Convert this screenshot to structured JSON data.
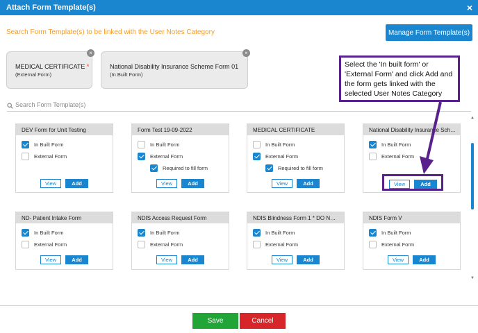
{
  "dialog": {
    "title": "Attach Form Template(s)",
    "close_icon": "×"
  },
  "header": {
    "subtitle": "Search Form Template(s) to be linked with the User Notes Category",
    "manage_button": "Manage Form Template(s)"
  },
  "selected": [
    {
      "name": "MEDICAL CERTIFICATE",
      "required_mark": "*",
      "type": "(External Form)"
    },
    {
      "name": "National Disability Insurance Scheme Form 01",
      "required_mark": "",
      "type": "(In Built Form)"
    }
  ],
  "search": {
    "placeholder": "Search Form Template(s)",
    "value": ""
  },
  "labels": {
    "in_built": "In Built Form",
    "external": "External Form",
    "required": "Required to fill form",
    "view": "View",
    "add": "Add"
  },
  "cards": [
    {
      "title": "DEV Form for Unit Testing",
      "in_built": true,
      "external": false
    },
    {
      "title": "Form Test 19-09-2022",
      "in_built": false,
      "external": true,
      "required": true
    },
    {
      "title": "MEDICAL CERTIFICATE",
      "in_built": false,
      "external": true,
      "required": true
    },
    {
      "title": "National Disability Insurance Sche...",
      "in_built": true,
      "external": false
    },
    {
      "title": "ND- Patient Intake Form",
      "in_built": true,
      "external": false
    },
    {
      "title": "NDIS Access Request Form",
      "in_built": true,
      "external": false
    },
    {
      "title": "NDIS Blindness Form 1 * DO NOT ...",
      "in_built": true,
      "external": false
    },
    {
      "title": "NDIS Form V",
      "in_built": true,
      "external": false
    }
  ],
  "callout": {
    "text": "Select the 'In built form' or 'External Form' and click Add and the form gets linked with the selected User Notes Category"
  },
  "footer": {
    "save": "Save",
    "cancel": "Cancel"
  },
  "colors": {
    "primary": "#1a86d0",
    "accent_orange": "#f39c2a",
    "annotation_purple": "#58218c",
    "save_green": "#21a537",
    "cancel_red": "#d7262a"
  }
}
